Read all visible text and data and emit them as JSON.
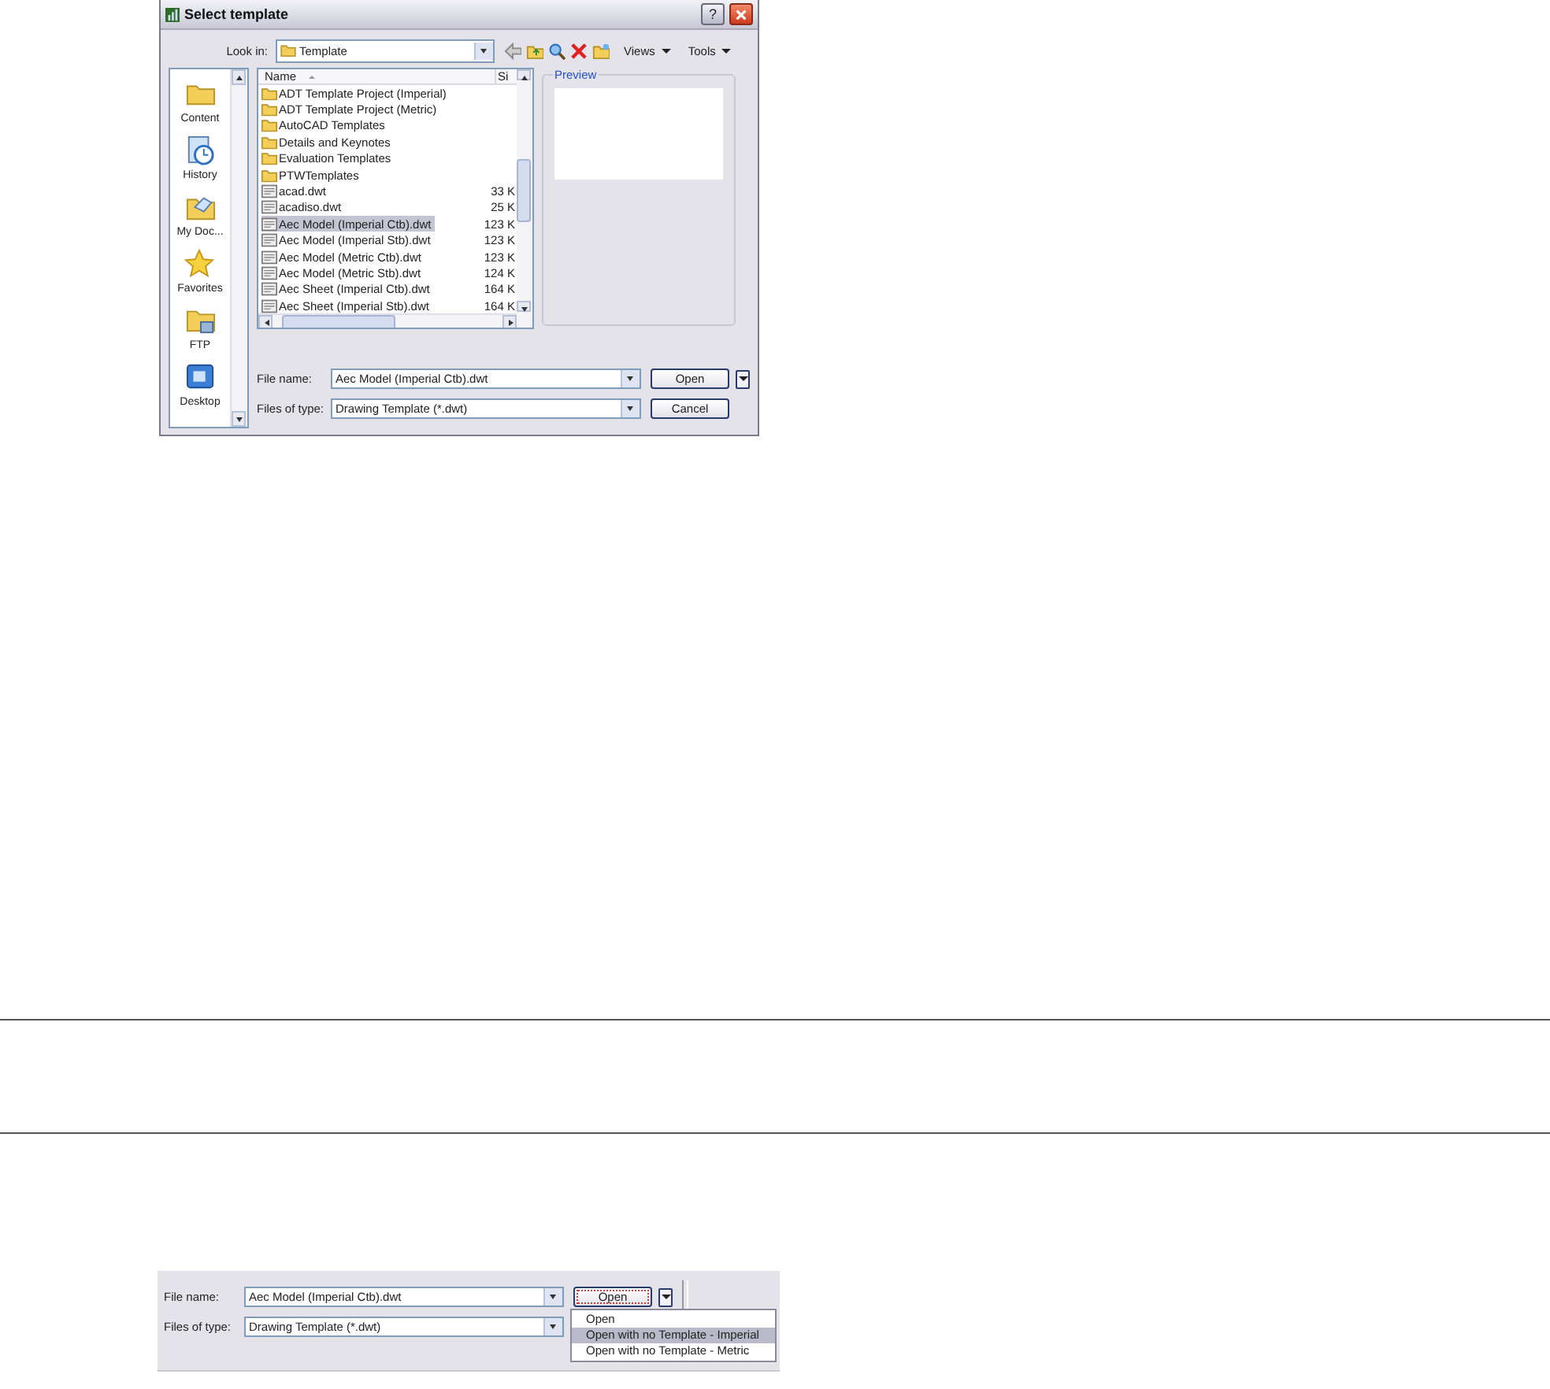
{
  "dialog": {
    "title": "Select template",
    "help": "?",
    "look_in": {
      "label": "Look in:",
      "value": "Template"
    },
    "toolbar_menus": [
      "Views",
      "Tools"
    ],
    "places": [
      {
        "label": "Content",
        "kind": "folder"
      },
      {
        "label": "History",
        "kind": "history"
      },
      {
        "label": "My Doc...",
        "kind": "documents"
      },
      {
        "label": "Favorites",
        "kind": "star"
      },
      {
        "label": "FTP",
        "kind": "ftp"
      },
      {
        "label": "Desktop",
        "kind": "desktop"
      }
    ],
    "columns": [
      "Name",
      "Si"
    ],
    "files": [
      {
        "name": "ADT Template Project (Imperial)",
        "kind": "folder",
        "selected": false
      },
      {
        "name": "ADT Template Project (Metric)",
        "kind": "folder",
        "selected": false
      },
      {
        "name": "AutoCAD Templates",
        "kind": "folder",
        "selected": false
      },
      {
        "name": "Details and Keynotes",
        "kind": "folder",
        "selected": false
      },
      {
        "name": "Evaluation Templates",
        "kind": "folder",
        "selected": false
      },
      {
        "name": "PTWTemplates",
        "kind": "folder",
        "selected": false
      },
      {
        "name": "acad.dwt",
        "size": "33 K",
        "kind": "file",
        "selected": false
      },
      {
        "name": "acadiso.dwt",
        "size": "25 K",
        "kind": "file",
        "selected": false
      },
      {
        "name": "Aec Model (Imperial Ctb).dwt",
        "size": "123 K",
        "kind": "file",
        "selected": true
      },
      {
        "name": "Aec Model (Imperial Stb).dwt",
        "size": "123 K",
        "kind": "file",
        "selected": false
      },
      {
        "name": "Aec Model (Metric Ctb).dwt",
        "size": "123 K",
        "kind": "file",
        "selected": false
      },
      {
        "name": "Aec Model (Metric Stb).dwt",
        "size": "124 K",
        "kind": "file",
        "selected": false
      },
      {
        "name": "Aec Sheet (Imperial Ctb).dwt",
        "size": "164 K",
        "kind": "file",
        "selected": false
      },
      {
        "name": "Aec Sheet (Imperial Stb).dwt",
        "size": "164 K",
        "kind": "file",
        "selected": false
      }
    ],
    "preview_label": "Preview",
    "file_name": {
      "label": "File name:",
      "value": "Aec Model (Imperial Ctb).dwt"
    },
    "file_type": {
      "label": "Files of type:",
      "value": "Drawing Template (*.dwt)"
    },
    "buttons": [
      "Open",
      "Cancel"
    ]
  },
  "detail": {
    "file_name": {
      "label": "File name:",
      "value": "Aec Model (Imperial Ctb).dwt"
    },
    "file_type": {
      "label": "Files of type:",
      "value": "Drawing Template (*.dwt)"
    },
    "open_button": "Open",
    "menu": [
      {
        "label": "Open",
        "selected": false
      },
      {
        "label": "Open with no Template - Imperial",
        "selected": true
      },
      {
        "label": "Open with no Template - Metric",
        "selected": false
      }
    ]
  }
}
